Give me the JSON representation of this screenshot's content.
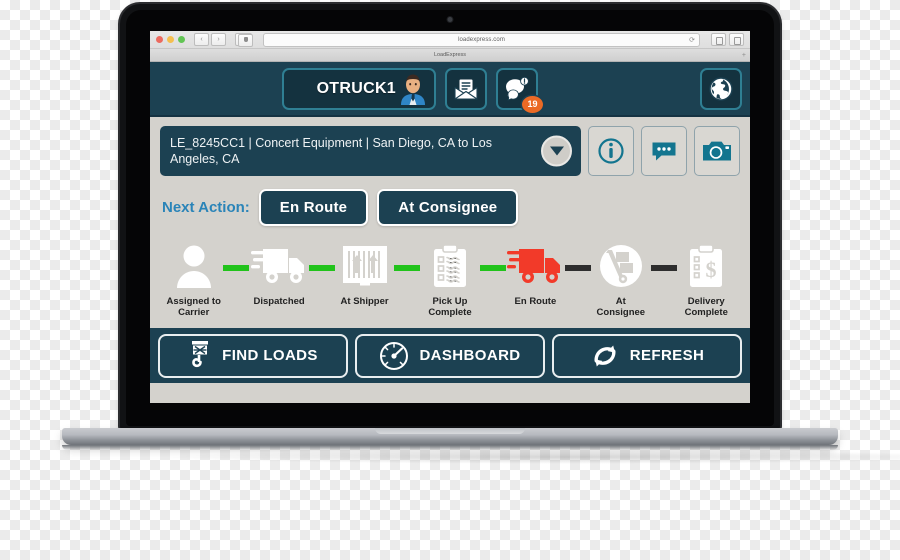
{
  "browser": {
    "url": "loadexpress.com",
    "tab_title": "LoadExpress",
    "reload_glyph": "⟳",
    "back_glyph": "‹",
    "forward_glyph": "›",
    "new_tab_glyph": "+"
  },
  "header": {
    "username": "OTRUCK1",
    "avatar_name": "driver-avatar",
    "mail_icon": "envelope-icon",
    "chat_icon": "chat-alert-icon",
    "chat_badge": "19",
    "globe_icon": "globe-icon",
    "accent_border": "#2f7f93",
    "bg": "#1c4152"
  },
  "load": {
    "text": "LE_8245CC1 | Concert Equipment | San Diego, CA to Los Angeles, CA",
    "id": "LE_8245CC1",
    "commodity": "Concert Equipment",
    "origin": "San Diego, CA",
    "destination": "Los Angeles, CA",
    "dropdown_icon": "chevron-down-icon",
    "actions": [
      {
        "name": "info-button",
        "icon": "info-circle-icon"
      },
      {
        "name": "messages-button",
        "icon": "chat-dots-icon"
      },
      {
        "name": "camera-button",
        "icon": "camera-icon"
      }
    ]
  },
  "next_action": {
    "label": "Next Action:",
    "label_color": "#2a84b8",
    "buttons": [
      {
        "label": "En Route",
        "name": "en-route-action-button"
      },
      {
        "label": "At Consignee",
        "name": "at-consignee-action-button"
      }
    ]
  },
  "tracker": {
    "current_step": "En Route",
    "done_color": "#21c31b",
    "todo_color": "#2e2e2e",
    "active_color": "#f23a29",
    "steps": [
      {
        "label": "Assigned to Carrier",
        "icon": "person-icon",
        "state": "done"
      },
      {
        "label": "Dispatched",
        "icon": "truck-icon",
        "state": "done"
      },
      {
        "label": "At Shipper",
        "icon": "warehouse-icon",
        "state": "done"
      },
      {
        "label": "Pick Up Complete",
        "icon": "clipboard-icon",
        "state": "done"
      },
      {
        "label": "En Route",
        "icon": "truck-icon",
        "state": "active"
      },
      {
        "label": "At Consignee",
        "icon": "handtruck-icon",
        "state": "todo"
      },
      {
        "label": "Delivery Complete",
        "icon": "invoice-icon",
        "state": "todo"
      }
    ],
    "connectors": [
      "done",
      "done",
      "done",
      "done",
      "todo",
      "todo"
    ]
  },
  "footer": {
    "buttons": [
      {
        "label": "FIND LOADS",
        "name": "find-loads-button",
        "icon": "hook-magnet-icon"
      },
      {
        "label": "DASHBOARD",
        "name": "dashboard-button",
        "icon": "gauge-icon"
      },
      {
        "label": "REFRESH",
        "name": "refresh-button",
        "icon": "refresh-icon"
      }
    ]
  }
}
